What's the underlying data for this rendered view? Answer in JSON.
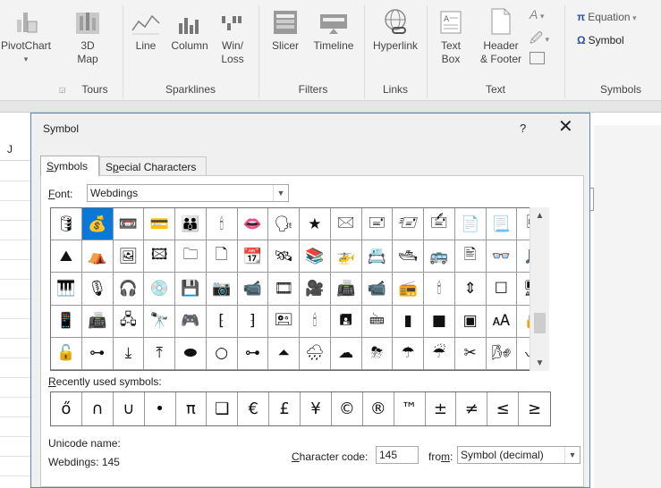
{
  "ribbon": {
    "pivotchart": "PivotChart",
    "map3d_line1": "3D",
    "map3d_line2": "Map",
    "line": "Line",
    "column": "Column",
    "winloss_line1": "Win/",
    "winloss_line2": "Loss",
    "slicer": "Slicer",
    "timeline": "Timeline",
    "hyperlink": "Hyperlink",
    "textbox_line1": "Text",
    "textbox_line2": "Box",
    "header_line1": "Header",
    "header_line2": "& Footer",
    "equation": "Equation",
    "symbol": "Symbol",
    "groups": {
      "tours": "Tours",
      "sparklines": "Sparklines",
      "filters": "Filters",
      "links": "Links",
      "text": "Text",
      "symbols": "Symbols"
    }
  },
  "sheet": {
    "column_header": "J"
  },
  "dialog": {
    "title": "Symbol",
    "help": "?",
    "close": "✕",
    "tabs": {
      "symbols_pre": "",
      "symbols_u": "S",
      "symbols_post": "ymbols",
      "special_pre": "S",
      "special_u": "p",
      "special_post": "ecial Characters"
    },
    "font_label_u": "F",
    "font_label_rest": "ont:",
    "font_value": "Webdings",
    "symbols": [
      "🛢",
      "💰",
      "📼",
      "💳",
      "👪",
      "🕯",
      "👄",
      "🗣",
      "★",
      "🖂",
      "🖃",
      "🖅",
      "🖆",
      "📄",
      "📃",
      "🖻",
      "⛰",
      "⛺",
      "🖼",
      "🖾",
      "🗀",
      "🗋",
      "📆",
      "🛰",
      "📚",
      "🚁",
      "📇",
      "🛥",
      "🚌",
      "🖹",
      "👓",
      "🎵",
      "🎹",
      "🎙",
      "🎧",
      "💿",
      "💾",
      "📷",
      "📹",
      "🎞",
      "🎥",
      "📠",
      "📹",
      "📻",
      "🕯",
      "⇕",
      "☐",
      "🖥",
      "📱",
      "📠",
      "🖧",
      "🔭",
      "🎮",
      "⁅",
      "⁆",
      "🖭",
      "🕯",
      "🖪",
      "🖮",
      "▮",
      "■",
      "▣",
      "🗚",
      "🔒",
      "🔓",
      "⊶",
      "⤓",
      "⤒",
      "⬬",
      "○",
      "⊶",
      "⏶",
      "🌧",
      "☁",
      "⛈",
      "☂",
      "☔",
      "✂",
      "🌬",
      "〰"
    ],
    "recently_label_u": "R",
    "recently_label_rest": "ecently used symbols:",
    "recent": [
      "ő",
      "∩",
      "∪",
      "•",
      "π",
      "❑",
      "€",
      "£",
      "¥",
      "©",
      "®",
      "™",
      "±",
      "≠",
      "≤",
      "≥"
    ],
    "unicode_name_label": "Unicode name:",
    "unicode_name_value": "Webdings: 145",
    "char_code_label_pre": "",
    "char_code_label_u": "C",
    "char_code_label_rest": "haracter code:",
    "char_code_value": "145",
    "from_label_pre": "fro",
    "from_label_u": "m",
    "from_label_rest": ":",
    "from_value": "Symbol (decimal)"
  }
}
